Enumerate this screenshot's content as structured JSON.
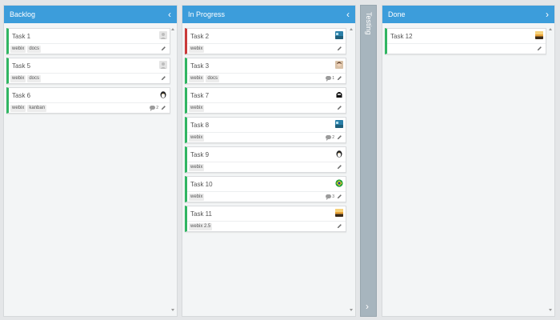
{
  "columns": {
    "backlog": {
      "title": "Backlog",
      "arrow": "‹"
    },
    "in_progress": {
      "title": "In Progress",
      "arrow": "‹"
    },
    "testing": {
      "title": "Testing",
      "arrow": "›"
    },
    "done": {
      "title": "Done",
      "arrow": "›"
    }
  },
  "cards": {
    "task1": {
      "title": "Task 1",
      "tags": [
        "webix",
        "docs"
      ],
      "avatar": "generic-user-icon"
    },
    "task5": {
      "title": "Task 5",
      "tags": [
        "webix",
        "docs"
      ],
      "avatar": "generic-user-icon"
    },
    "task6": {
      "title": "Task 6",
      "tags": [
        "webix",
        "kanban"
      ],
      "comments": "2",
      "avatar": "penguin-avatar"
    },
    "task2": {
      "title": "Task 2",
      "tags": [
        "webix"
      ],
      "avatar": "landscape-avatar",
      "status_color": "#c93a3a"
    },
    "task3": {
      "title": "Task 3",
      "tags": [
        "webix",
        "docs"
      ],
      "comments": "1",
      "avatar": "person-avatar"
    },
    "task7": {
      "title": "Task 7",
      "tags": [
        "webix"
      ],
      "avatar": "skull-avatar"
    },
    "task8": {
      "title": "Task 8",
      "tags": [
        "webix"
      ],
      "comments": "2",
      "avatar": "landscape-avatar"
    },
    "task9": {
      "title": "Task 9",
      "tags": [
        "webix"
      ],
      "avatar": "penguin-avatar"
    },
    "task10": {
      "title": "Task 10",
      "tags": [
        "webix"
      ],
      "comments": "3",
      "avatar": "flag-avatar"
    },
    "task11": {
      "title": "Task 11",
      "tags": [
        "webix 2.5"
      ],
      "avatar": "sunset-avatar"
    },
    "task12": {
      "title": "Task 12",
      "tags": [],
      "avatar": "sunset-avatar"
    }
  },
  "colors": {
    "header": "#3c9ddb",
    "collapsed_column": "#a7b5be",
    "status_green": "#30b562",
    "status_red": "#c93a3a"
  }
}
